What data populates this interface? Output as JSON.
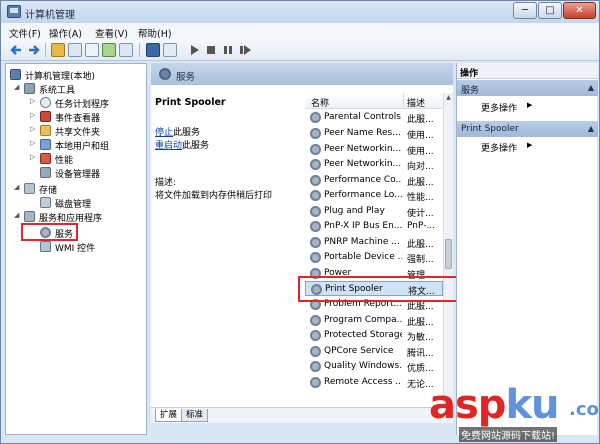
{
  "window": {
    "title": "计算机管理"
  },
  "title_buttons": {
    "minimize": "─",
    "maximize": "□",
    "close": "✕"
  },
  "menu": [
    "文件(F)",
    "操作(A)",
    "查看(V)",
    "帮助(H)"
  ],
  "tree": {
    "root": "计算机管理(本地)",
    "items": [
      {
        "label": "系统工具",
        "indent": 1,
        "expanded": true
      },
      {
        "label": "任务计划程序",
        "indent": 2
      },
      {
        "label": "事件查看器",
        "indent": 2
      },
      {
        "label": "共享文件夹",
        "indent": 2
      },
      {
        "label": "本地用户和组",
        "indent": 2
      },
      {
        "label": "性能",
        "indent": 2
      },
      {
        "label": "设备管理器",
        "indent": 2
      },
      {
        "label": "存储",
        "indent": 1,
        "expanded": true
      },
      {
        "label": "磁盘管理",
        "indent": 2
      },
      {
        "label": "服务和应用程序",
        "indent": 1,
        "expanded": true
      },
      {
        "label": "服务",
        "indent": 2,
        "highlighted": true
      },
      {
        "label": "WMI 控件",
        "indent": 2
      }
    ]
  },
  "center": {
    "header": "服务",
    "selected_service": "Print Spooler",
    "stop_link": "停止",
    "stop_suffix": "此服务",
    "restart_link": "重启动",
    "restart_suffix": "此服务",
    "desc_label": "描述:",
    "desc_text": "将文件加载到内存供稍后打印"
  },
  "list": {
    "col_name": "名称",
    "col_desc": "描述",
    "rows": [
      {
        "name": "Parental Controls",
        "desc": "此服..."
      },
      {
        "name": "Peer Name Res...",
        "desc": "使用..."
      },
      {
        "name": "Peer Networkin...",
        "desc": "使用..."
      },
      {
        "name": "Peer Networkin...",
        "desc": "向对..."
      },
      {
        "name": "Performance Co...",
        "desc": "此服..."
      },
      {
        "name": "Performance Lo...",
        "desc": "性能..."
      },
      {
        "name": "Plug and Play",
        "desc": "使计..."
      },
      {
        "name": "PnP-X IP Bus En...",
        "desc": "PnP-..."
      },
      {
        "name": "PNRP Machine ...",
        "desc": "此服..."
      },
      {
        "name": "Portable Device ...",
        "desc": "强制..."
      },
      {
        "name": "Power",
        "desc": "管理..."
      },
      {
        "name": "Print Spooler",
        "desc": "将文...",
        "selected": true
      },
      {
        "name": "Problem Report...",
        "desc": "此服..."
      },
      {
        "name": "Program Compa...",
        "desc": "此服..."
      },
      {
        "name": "Protected Storage",
        "desc": "为敏..."
      },
      {
        "name": "QPCore Service",
        "desc": "腾讯..."
      },
      {
        "name": "Quality Windows...",
        "desc": "优质..."
      },
      {
        "name": "Remote Access ...",
        "desc": "无论..."
      }
    ]
  },
  "tabs": [
    "扩展",
    "标准"
  ],
  "actions": {
    "title": "操作",
    "sections": [
      {
        "label": "服务",
        "item": "更多操作"
      },
      {
        "label": "Print Spooler",
        "item": "更多操作"
      }
    ]
  },
  "watermark": {
    "main_red": "asp",
    "main_blue": "ku",
    "dot": ".com",
    "sub": "免费网站源码下载站!"
  }
}
